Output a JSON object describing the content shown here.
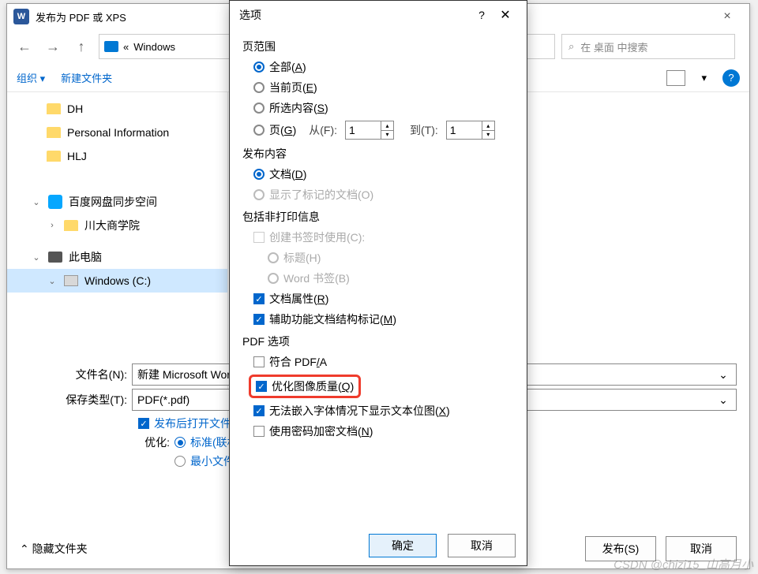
{
  "colors": {
    "accent": "#0066cc",
    "primary": "#0078d4"
  },
  "window": {
    "title": "发布为 PDF 或 XPS",
    "close": "×"
  },
  "nav": {
    "back_icon": "←",
    "fwd_icon": "→",
    "up_icon": "↑",
    "breadcrumb_prefix": "«",
    "breadcrumb": "Windows",
    "search_placeholder": "在 桌面 中搜索",
    "search_icon": "⌕"
  },
  "toolbar": {
    "organize": "组织",
    "new_folder": "新建文件夹",
    "dd": "▾",
    "help": "?"
  },
  "tree": {
    "items": [
      {
        "icon": "folder",
        "label": "DH"
      },
      {
        "icon": "folder",
        "label": "Personal Information"
      },
      {
        "icon": "folder",
        "label": "HLJ"
      }
    ],
    "baidu": {
      "chev": "⌄",
      "label": "百度网盘同步空间"
    },
    "baidu_child": {
      "chev": "›",
      "label": "川大商学院"
    },
    "pc": {
      "chev": "⌄",
      "label": "此电脑"
    },
    "selected": {
      "chev": "⌄",
      "label": "Windows (C:)"
    }
  },
  "form": {
    "filename_label": "文件名(N):",
    "filename_value": "新建 Microsoft Word",
    "type_label": "保存类型(T):",
    "type_value": "PDF(*.pdf)",
    "open_after": "发布后打开文件",
    "optimize_label": "优化:",
    "opt_standard": "标准(联机发布)(A)",
    "opt_min": "最小文件大小(M)"
  },
  "footer": {
    "hide_folders": "隐藏文件夹",
    "chev": "⌃",
    "publish": "发布(S)",
    "cancel": "取消"
  },
  "dialog": {
    "title": "选项",
    "help": "?",
    "close": "✕",
    "grp_range": "页范围",
    "range_all": "全部(A)",
    "range_current": "当前页(E)",
    "range_selection": "所选内容(S)",
    "range_pages": "页(G)",
    "from_label": "从(F):",
    "from_val": "1",
    "to_label": "到(T):",
    "to_val": "1",
    "grp_content": "发布内容",
    "content_doc": "文档(D)",
    "content_markup": "显示了标记的文档(O)",
    "grp_nonprint": "包括非打印信息",
    "np_bookmark": "创建书签时使用(C):",
    "np_heading": "标题(H)",
    "np_wordbm": "Word 书签(B)",
    "np_docprops": "文档属性(R)",
    "np_a11y": "辅助功能文档结构标记(M)",
    "grp_pdf": "PDF 选项",
    "pdf_pdfa": "符合 PDF/A",
    "pdf_imgq": "优化图像质量(Q)",
    "pdf_bitmap": "无法嵌入字体情况下显示文本位图(X)",
    "pdf_encrypt": "使用密码加密文档(N)",
    "ok": "确定",
    "cancel": "取消"
  },
  "watermark": "CSDN @chizi15_山高月小"
}
